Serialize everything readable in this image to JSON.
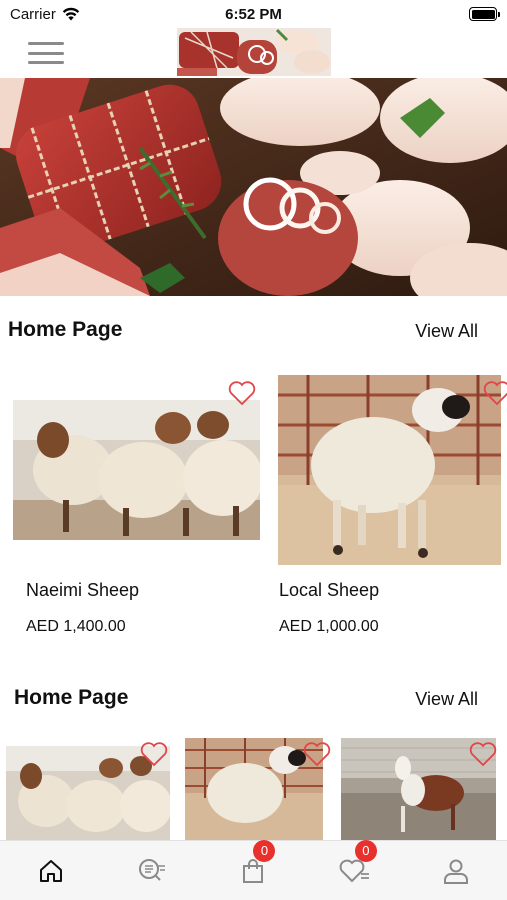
{
  "status_bar": {
    "carrier": "Carrier",
    "time": "6:52 PM"
  },
  "header": {
    "menu_icon": "hamburger-menu-icon",
    "logo_icon": "meat-logo-image"
  },
  "hero": {
    "image_icon": "meat-and-poultry-banner"
  },
  "sections": [
    {
      "title": "Home Page",
      "view_all": "View All",
      "products": [
        {
          "name": "Naeimi Sheep",
          "price": "AED 1,400.00",
          "image_icon": "naeimi-sheep-image"
        },
        {
          "name": "Local Sheep",
          "price": "AED 1,000.00",
          "image_icon": "local-sheep-image"
        }
      ]
    },
    {
      "title": "Home Page",
      "view_all": "View All",
      "products": [
        {
          "image_icon": "naeimi-sheep-image"
        },
        {
          "image_icon": "local-sheep-image"
        },
        {
          "image_icon": "goat-image"
        }
      ]
    }
  ],
  "tab_bar": {
    "tabs": [
      {
        "name": "home",
        "icon": "home-icon"
      },
      {
        "name": "search",
        "icon": "search-list-icon"
      },
      {
        "name": "cart",
        "icon": "shopping-bag-icon",
        "badge": "0"
      },
      {
        "name": "wishlist",
        "icon": "heart-list-icon",
        "badge": "0"
      },
      {
        "name": "account",
        "icon": "user-icon"
      }
    ]
  },
  "colors": {
    "accent": "#e8312d",
    "heart_outline": "#e0464a",
    "tab_bar_bg": "#f6f6f6",
    "icon_gray": "#8a8a8a"
  }
}
